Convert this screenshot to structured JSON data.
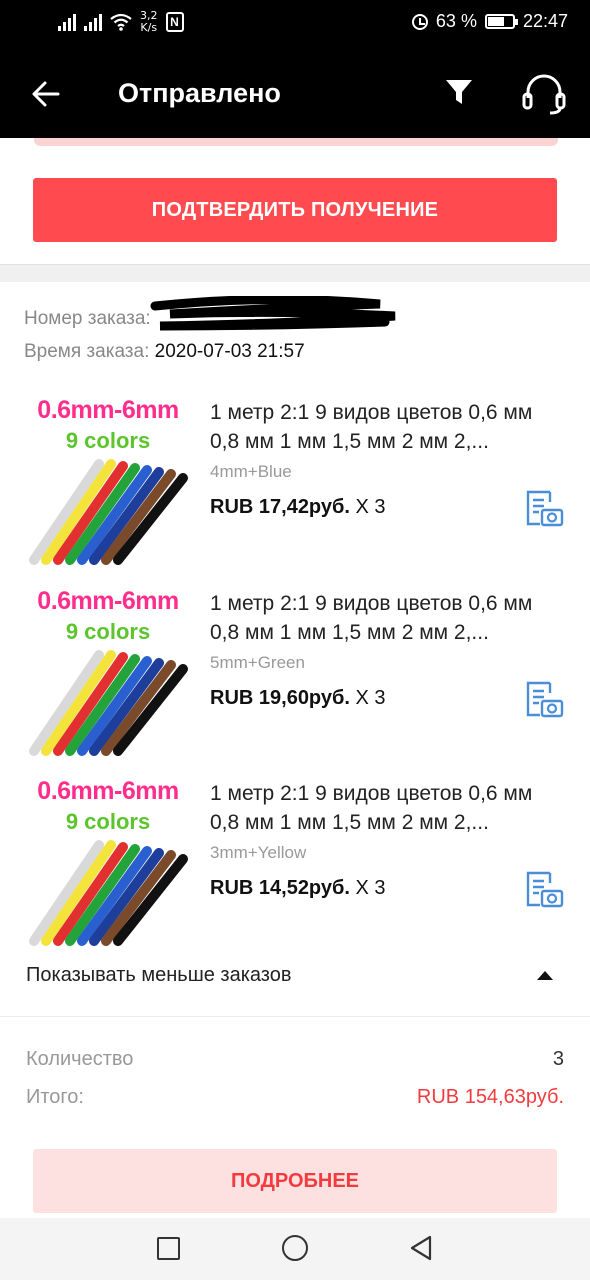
{
  "status_bar": {
    "speed_value": "3,2",
    "speed_unit": "K/s",
    "nfc_label": "N",
    "battery_percent": "63 %",
    "battery_level": 0.63,
    "time": "22:47"
  },
  "header": {
    "title": "Отправлено"
  },
  "confirm_button_label": "ПОДТВЕРДИТЬ ПОЛУЧЕНИЕ",
  "order": {
    "number_label": "Номер заказа:",
    "time_label": "Время заказа:",
    "time_value": "2020-07-03 21:57"
  },
  "items": [
    {
      "thumb_line1": "0.6mm-6mm",
      "thumb_line2": "9 colors",
      "title": "1 метр 2:1 9 видов цветов 0,6 мм 0,8 мм 1 мм 1,5 мм 2 мм 2,...",
      "sku": "4mm+Blue",
      "price": "RUB 17,42руб.",
      "qty": " X 3"
    },
    {
      "thumb_line1": "0.6mm-6mm",
      "thumb_line2": "9 colors",
      "title": "1 метр 2:1 9 видов цветов 0,6 мм 0,8 мм 1 мм 1,5 мм 2 мм 2,...",
      "sku": "5mm+Green",
      "price": "RUB 19,60руб.",
      "qty": " X 3"
    },
    {
      "thumb_line1": "0.6mm-6mm",
      "thumb_line2": "9 colors",
      "title": "1 метр 2:1 9 видов цветов 0,6 мм 0,8 мм 1 мм 1,5 мм 2 мм 2,...",
      "sku": "3mm+Yellow",
      "price": "RUB 14,52руб.",
      "qty": " X 3"
    }
  ],
  "show_less_label": "Показывать меньше заказов",
  "summary": {
    "quantity_label": "Количество",
    "quantity_value": "3",
    "total_label": "Итого:",
    "total_value": "RUB 154,63руб."
  },
  "details_button_label": "ПОДРОБНЕЕ",
  "colors": {
    "accent": "#ff4a4f",
    "price_red": "#f23b3f",
    "thumb_pink": "#ff2e8c",
    "thumb_green": "#5cc42c",
    "icon_blue": "#4a8ed8"
  },
  "icons": [
    "back-arrow-icon",
    "filter-icon",
    "support-headset-icon",
    "document-camera-icon",
    "caret-up-icon"
  ]
}
